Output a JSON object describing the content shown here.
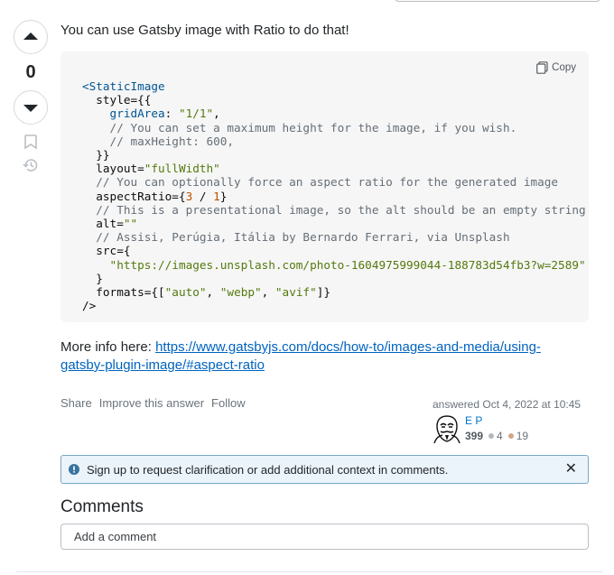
{
  "intro": "You can use Gatsby image with Ratio to do that!",
  "vote": {
    "count": "0"
  },
  "code": {
    "copy_label": "Copy",
    "lines": [
      [
        [
          "tag",
          "<StaticImage"
        ]
      ],
      [
        [
          "attr",
          "  style={{"
        ]
      ],
      [
        [
          "prop",
          "    gridArea"
        ],
        [
          "attr",
          ": "
        ],
        [
          "str",
          "\"1/1\""
        ],
        [
          "attr",
          ","
        ]
      ],
      [
        [
          "com",
          "    // You can set a maximum height for the image, if you wish."
        ]
      ],
      [
        [
          "com",
          "    // maxHeight: 600,"
        ]
      ],
      [
        [
          "attr",
          "  }}"
        ]
      ],
      [
        [
          "attr",
          "  layout="
        ],
        [
          "str",
          "\"fullWidth\""
        ]
      ],
      [
        [
          "com",
          "  // You can optionally force an aspect ratio for the generated image"
        ]
      ],
      [
        [
          "attr",
          "  aspectRatio={"
        ],
        [
          "num",
          "3"
        ],
        [
          "attr",
          " / "
        ],
        [
          "num",
          "1"
        ],
        [
          "attr",
          "}"
        ]
      ],
      [
        [
          "com",
          "  // This is a presentational image, so the alt should be an empty string"
        ]
      ],
      [
        [
          "attr",
          "  alt="
        ],
        [
          "str",
          "\"\""
        ]
      ],
      [
        [
          "com",
          "  // Assisi, Perúgia, Itália by Bernardo Ferrari, via Unsplash"
        ]
      ],
      [
        [
          "attr",
          "  src={"
        ]
      ],
      [
        [
          "str",
          "    \"https://images.unsplash.com/photo-1604975999044-188783d54fb3?w=2589\""
        ]
      ],
      [
        [
          "attr",
          "  }"
        ]
      ],
      [
        [
          "attr",
          "  formats={["
        ],
        [
          "str",
          "\"auto\""
        ],
        [
          "attr",
          ", "
        ],
        [
          "str",
          "\"webp\""
        ],
        [
          "attr",
          ", "
        ],
        [
          "str",
          "\"avif\""
        ],
        [
          "attr",
          "]}"
        ]
      ],
      [
        [
          "attr",
          "/>"
        ]
      ]
    ]
  },
  "more_info": {
    "prefix": "More info here: ",
    "link_text": "https://www.gatsbyjs.com/docs/how-to/images-and-media/using-gatsby-plugin-image/#aspect-ratio"
  },
  "post_menu": {
    "share": "Share",
    "improve": "Improve this answer",
    "follow": "Follow"
  },
  "user": {
    "answered": "answered Oct 4, 2022 at 10:45",
    "name": "E P",
    "reputation": "399",
    "silver": "4",
    "bronze": "19",
    "silver_color": "#b4b8bc",
    "bronze_color": "#d1a684"
  },
  "notice": {
    "text": "Sign up to request clarification or add additional context in comments.",
    "close": "✕"
  },
  "comments": {
    "title": "Comments",
    "add_label": "Add a comment"
  },
  "icons": {
    "upvote": "arrow-up-icon",
    "downvote": "arrow-down-icon",
    "bookmark": "bookmark-icon",
    "history": "history-icon",
    "copy": "copy-icon",
    "info": "info-icon"
  }
}
